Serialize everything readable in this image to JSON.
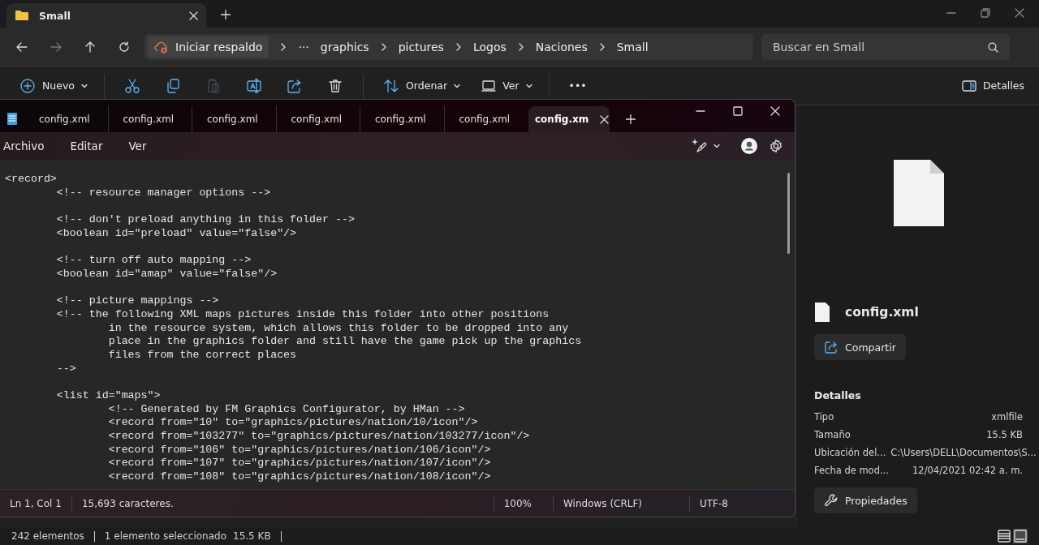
{
  "explorer": {
    "tab": {
      "title": "Small"
    },
    "address": {
      "backup_label": "Iniciar respaldo",
      "overflow": "···",
      "crumbs": [
        "graphics",
        "pictures",
        "Logos",
        "Naciones",
        "Small"
      ]
    },
    "search": {
      "placeholder": "Buscar en Small"
    },
    "toolbar": [
      {
        "kind": "menu",
        "label": "Nuevo"
      },
      {
        "kind": "icon",
        "disabled": false
      },
      {
        "kind": "icon",
        "disabled": false
      },
      {
        "kind": "icon",
        "disabled": true
      },
      {
        "kind": "icon",
        "disabled": false
      },
      {
        "kind": "icon",
        "disabled": false
      },
      {
        "kind": "icon",
        "disabled": false
      },
      {
        "kind": "menu",
        "label": "Ordenar"
      },
      {
        "kind": "menu",
        "label": "Ver"
      },
      {
        "kind": "more",
        "label": "•••"
      }
    ],
    "details_toggle": "Detalles",
    "details": {
      "file_name": "config.xml",
      "share": "Compartir",
      "heading": "Detalles",
      "rows": [
        {
          "label": "Tipo",
          "value": "xmlfile"
        },
        {
          "label": "Tamaño",
          "value": "15.5 KB"
        },
        {
          "label": "Ubicación del...",
          "value": "C:\\Users\\DELL\\Documentos\\S..."
        },
        {
          "label": "Fecha de mod...",
          "value": "12/04/2021 02:42 a. m."
        }
      ],
      "properties": "Propiedades"
    },
    "status": {
      "count": "242 elementos",
      "selection": "1 elemento seleccionado",
      "size": "15.5 KB",
      "views": [
        {
          "selected": false
        },
        {
          "selected": true
        }
      ]
    }
  },
  "notepad": {
    "tabs": [
      {
        "label": "config.xml",
        "selected": false
      },
      {
        "label": "config.xml",
        "selected": false
      },
      {
        "label": "config.xml",
        "selected": false
      },
      {
        "label": "config.xml",
        "selected": false
      },
      {
        "label": "config.xml",
        "selected": false
      },
      {
        "label": "config.xml",
        "selected": false
      },
      {
        "label": "config.xm",
        "selected": true
      }
    ],
    "menu": [
      "Archivo",
      "Editar",
      "Ver"
    ],
    "paragraphs": [
      [
        "<record>",
        "\t<!-- resource manager options -->"
      ],
      [
        "\t<!-- don't preload anything in this folder -->",
        "\t<boolean id=\"preload\" value=\"false\"/>"
      ],
      [
        "\t<!-- turn off auto mapping -->",
        "\t<boolean id=\"amap\" value=\"false\"/>"
      ],
      [
        "\t<!-- picture mappings -->",
        "\t<!-- the following XML maps pictures inside this folder into other positions",
        "\t\tin the resource system, which allows this folder to be dropped into any",
        "\t\tplace in the graphics folder and still have the game pick up the graphics",
        "\t\tfiles from the correct places",
        "\t-->"
      ],
      [
        "\t<list id=\"maps\">",
        "\t\t<!-- Generated by FM Graphics Configurator, by HMan -->",
        "\t\t<record from=\"10\" to=\"graphics/pictures/nation/10/icon\"/>",
        "\t\t<record from=\"103277\" to=\"graphics/pictures/nation/103277/icon\"/>",
        "\t\t<record from=\"106\" to=\"graphics/pictures/nation/106/icon\"/>",
        "\t\t<record from=\"107\" to=\"graphics/pictures/nation/107/icon\"/>",
        "\t\t<record from=\"108\" to=\"graphics/pictures/nation/108/icon\"/>"
      ]
    ],
    "status": {
      "position": "Ln 1, Col 1",
      "characters": "15,693 caracteres.",
      "zoom": "100%",
      "line_ending": "Windows (CRLF)",
      "encoding": "UTF-8"
    }
  }
}
